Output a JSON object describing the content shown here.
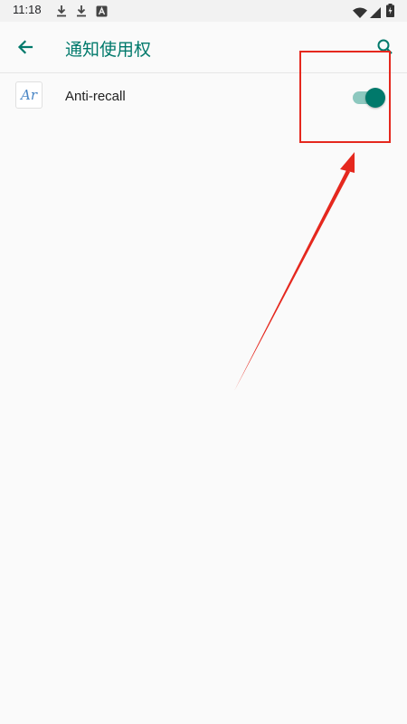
{
  "status_bar": {
    "time": "11:18",
    "left_icons": [
      "download-icon",
      "download-icon",
      "notification-a-icon"
    ],
    "right_icons": [
      "wifi-icon",
      "signal-icon",
      "battery-charging-icon"
    ]
  },
  "app_bar": {
    "back_icon": "arrow-back-icon",
    "title": "通知使用权",
    "search_icon": "search-icon"
  },
  "apps": [
    {
      "icon_text": "Ar",
      "label": "Anti-recall",
      "enabled": true
    }
  ],
  "annotation": {
    "color": "#e5281e"
  },
  "colors": {
    "accent": "#00796b",
    "accent_track": "#8dc8bf",
    "background": "#fafafa"
  }
}
